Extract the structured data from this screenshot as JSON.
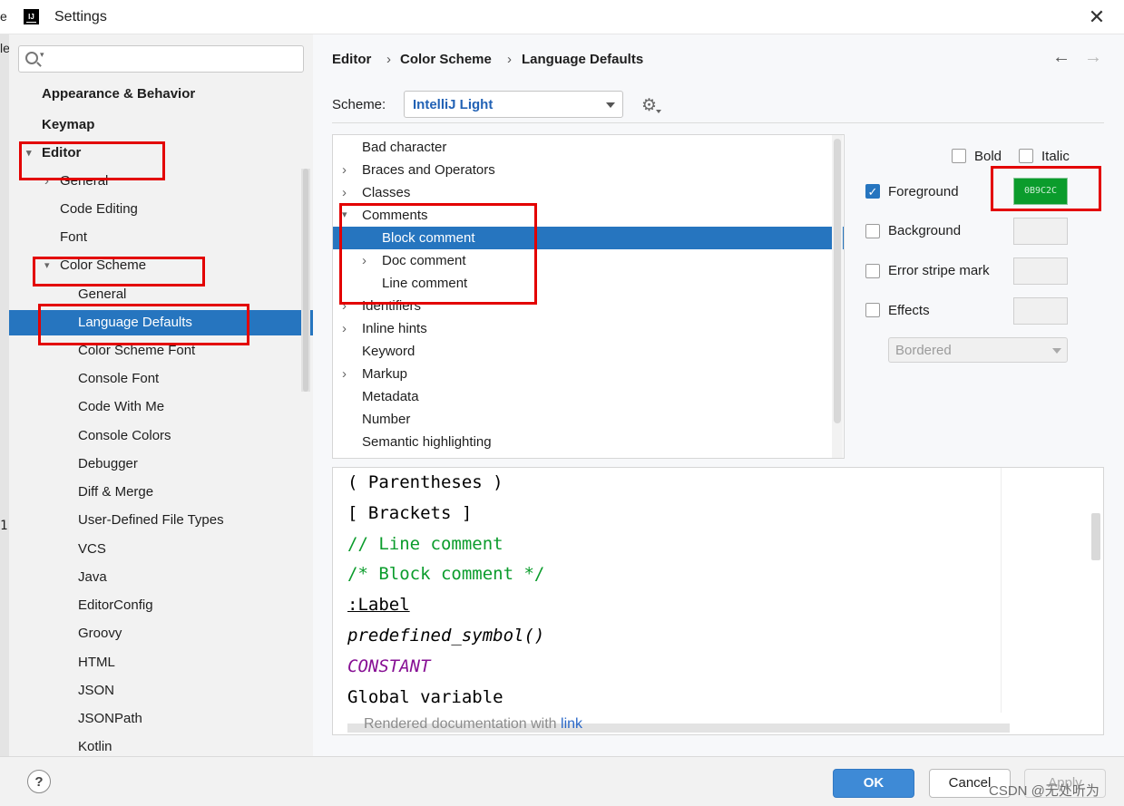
{
  "window": {
    "title": "Settings",
    "close_glyph": "✕",
    "logo_text": "IJ"
  },
  "background_window_fragments": [
    "e",
    "le",
    "1"
  ],
  "search": {
    "placeholder": "",
    "icon": "search-icon"
  },
  "sidebar": {
    "items": [
      {
        "label": "Appearance & Behavior",
        "bold": true,
        "level": 0,
        "chevron": ""
      },
      {
        "label": "Keymap",
        "bold": true,
        "level": 0,
        "chevron": ""
      },
      {
        "label": "Editor",
        "bold": true,
        "level": 0,
        "chevron": "expanded"
      },
      {
        "label": "General",
        "level": 1,
        "chevron": "collapsed"
      },
      {
        "label": "Code Editing",
        "level": 1,
        "chevron": ""
      },
      {
        "label": "Font",
        "level": 1,
        "chevron": ""
      },
      {
        "label": "Color Scheme",
        "level": 1,
        "chevron": "expanded"
      },
      {
        "label": "General",
        "level": 2,
        "chevron": ""
      },
      {
        "label": "Language Defaults",
        "level": 2,
        "chevron": "",
        "selected": true
      },
      {
        "label": "Color Scheme Font",
        "level": 2,
        "chevron": ""
      },
      {
        "label": "Console Font",
        "level": 2,
        "chevron": ""
      },
      {
        "label": "Code With Me",
        "level": 2,
        "chevron": ""
      },
      {
        "label": "Console Colors",
        "level": 2,
        "chevron": ""
      },
      {
        "label": "Debugger",
        "level": 2,
        "chevron": ""
      },
      {
        "label": "Diff & Merge",
        "level": 2,
        "chevron": ""
      },
      {
        "label": "User-Defined File Types",
        "level": 2,
        "chevron": ""
      },
      {
        "label": "VCS",
        "level": 2,
        "chevron": ""
      },
      {
        "label": "Java",
        "level": 2,
        "chevron": ""
      },
      {
        "label": "EditorConfig",
        "level": 2,
        "chevron": ""
      },
      {
        "label": "Groovy",
        "level": 2,
        "chevron": ""
      },
      {
        "label": "HTML",
        "level": 2,
        "chevron": ""
      },
      {
        "label": "JSON",
        "level": 2,
        "chevron": ""
      },
      {
        "label": "JSONPath",
        "level": 2,
        "chevron": ""
      },
      {
        "label": "Kotlin",
        "level": 2,
        "chevron": ""
      }
    ]
  },
  "breadcrumb": {
    "items": [
      "Editor",
      "Color Scheme",
      "Language Defaults"
    ],
    "separator": "›",
    "back": "←",
    "forward": "→"
  },
  "scheme": {
    "label": "Scheme:",
    "value": "IntelliJ Light",
    "gear_icon": "gear-icon"
  },
  "tree": {
    "items": [
      {
        "label": "Bad character",
        "indent": 0,
        "chevron": ""
      },
      {
        "label": "Braces and Operators",
        "indent": 0,
        "chevron": "collapsed"
      },
      {
        "label": "Classes",
        "indent": 0,
        "chevron": "collapsed"
      },
      {
        "label": "Comments",
        "indent": 0,
        "chevron": "expanded"
      },
      {
        "label": "Block comment",
        "indent": 1,
        "chevron": "",
        "selected": true
      },
      {
        "label": "Doc comment",
        "indent": 1,
        "chevron": "collapsed"
      },
      {
        "label": "Line comment",
        "indent": 1,
        "chevron": ""
      },
      {
        "label": "Identifiers",
        "indent": 0,
        "chevron": "collapsed"
      },
      {
        "label": "Inline hints",
        "indent": 0,
        "chevron": "collapsed"
      },
      {
        "label": "Keyword",
        "indent": 0,
        "chevron": ""
      },
      {
        "label": "Markup",
        "indent": 0,
        "chevron": "collapsed"
      },
      {
        "label": "Metadata",
        "indent": 0,
        "chevron": ""
      },
      {
        "label": "Number",
        "indent": 0,
        "chevron": ""
      },
      {
        "label": "Semantic highlighting",
        "indent": 0,
        "chevron": ""
      }
    ]
  },
  "attributes": {
    "bold": {
      "label": "Bold",
      "checked": false
    },
    "italic": {
      "label": "Italic",
      "checked": false
    },
    "foreground": {
      "label": "Foreground",
      "checked": true,
      "color": "0B9C2C"
    },
    "background": {
      "label": "Background",
      "checked": false
    },
    "error_stripe": {
      "label": "Error stripe mark",
      "checked": false
    },
    "effects": {
      "label": "Effects",
      "checked": false,
      "style": "Bordered"
    }
  },
  "preview": {
    "lines": [
      {
        "text": "( Parentheses )",
        "color": "#000000",
        "style": "normal"
      },
      {
        "text": "[ Brackets ]",
        "color": "#000000",
        "style": "normal"
      },
      {
        "text": "// Line comment",
        "color": "#0b9c2c",
        "style": "normal"
      },
      {
        "text": "/* Block comment */",
        "color": "#0b9c2c",
        "style": "normal"
      },
      {
        "text": ":Label",
        "color": "#000000",
        "style": "underline"
      },
      {
        "text": "predefined_symbol()",
        "color": "#000000",
        "style": "italic"
      },
      {
        "text": "CONSTANT",
        "color": "#871094",
        "style": "italic"
      },
      {
        "text": "Global variable",
        "color": "#000000",
        "style": "normal"
      }
    ],
    "doc_text": "Rendered documentation with",
    "doc_link": "link"
  },
  "footer": {
    "help": "?",
    "ok": "OK",
    "cancel": "Cancel",
    "apply": "Apply",
    "watermark": "CSDN @无处听为"
  },
  "colors": {
    "accent": "#2675bf",
    "highlight_box": "#e30000",
    "comment_green": "#0b9c2c"
  }
}
